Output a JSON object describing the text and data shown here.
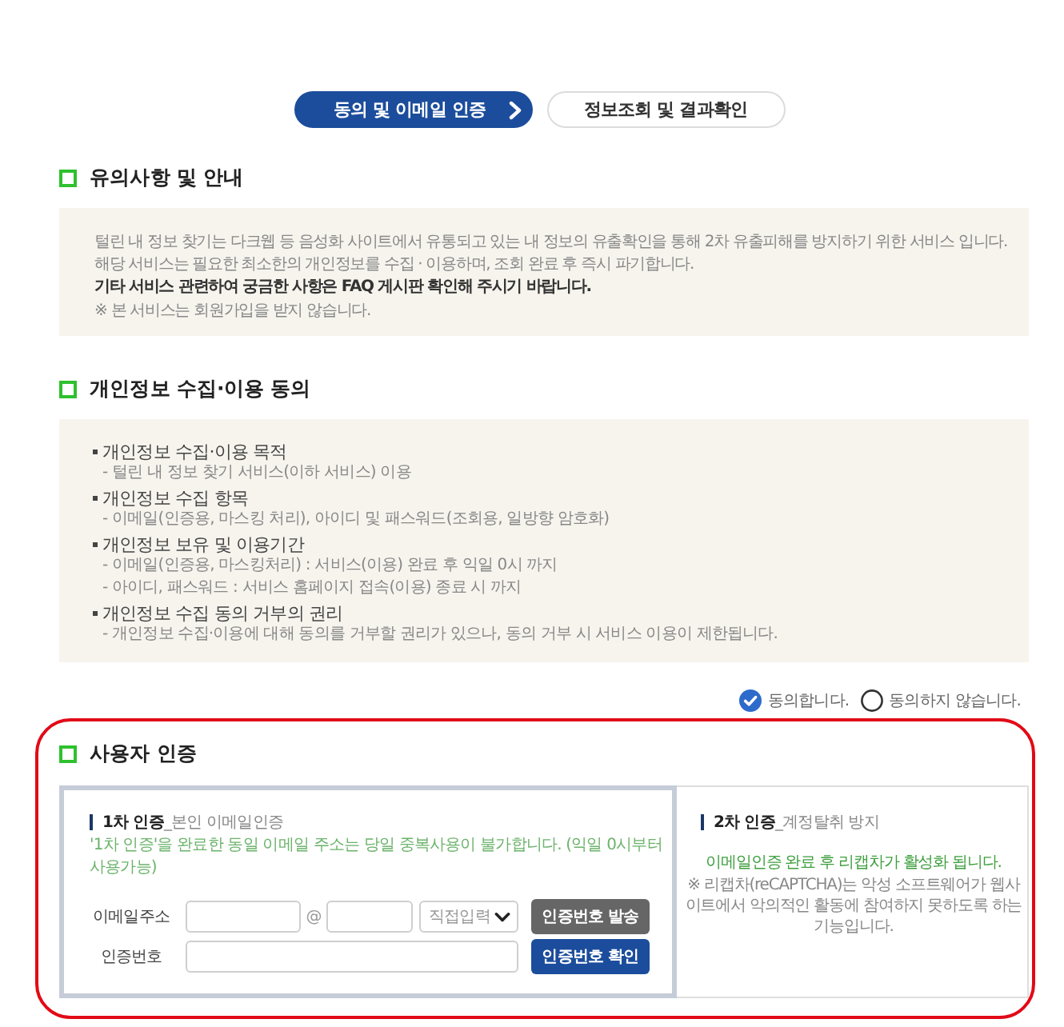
{
  "steps": [
    {
      "label": "동의 및 이메일 인증",
      "selected": true
    },
    {
      "label": "정보조회 및 결과확인",
      "selected": false
    }
  ],
  "notice": {
    "title": "유의사항 및 안내",
    "lines": [
      {
        "text": "털린 내 정보 찾기는 다크웹 등 음성화 사이트에서 유통되고 있는 내 정보의 유출확인을 통해 2차 유출피해를 방지하기 위한 서비스 입니다.",
        "bold": false
      },
      {
        "text": "해당 서비스는 필요한 최소한의 개인정보를 수집 · 이용하며, 조회 완료 후 즉시 파기합니다.",
        "bold": false
      },
      {
        "text": "기타 서비스 관련하여 궁금한 사항은 FAQ 게시판 확인해 주시기 바랍니다.",
        "bold": true
      },
      {
        "text": "※ 본 서비스는 회원가입을 받지 않습니다.",
        "bold": false
      }
    ]
  },
  "consent": {
    "title": "개인정보 수집·이용 동의",
    "items": [
      {
        "heading": "개인정보 수집·이용 목적",
        "details": [
          "- 털린 내 정보 찾기 서비스(이하 서비스) 이용"
        ]
      },
      {
        "heading": "개인정보 수집 항목",
        "details": [
          "- 이메일(인증용, 마스킹 처리), 아이디 및 패스워드(조회용, 일방향 암호화)"
        ]
      },
      {
        "heading": "개인정보 보유 및 이용기간",
        "details": [
          "- 이메일(인증용, 마스킹처리) : 서비스(이용) 완료 후 익일 0시 까지",
          "- 아이디, 패스워드 : 서비스 홈페이지 접속(이용) 종료 시 까지"
        ]
      },
      {
        "heading": "개인정보 수집 동의 거부의 권리",
        "details": [
          "- 개인정보 수집·이용에 대해 동의를 거부할 권리가 있으나, 동의 거부 시 서비스 이용이 제한됩니다."
        ]
      }
    ],
    "options": [
      {
        "label": "동의합니다.",
        "selected": true
      },
      {
        "label": "동의하지 않습니다.",
        "selected": false
      }
    ]
  },
  "user_auth": {
    "title": "사용자 인증",
    "first": {
      "title": "1차 인증",
      "subtitle": "_본인 이메일인증",
      "notice": "'1차 인증'을 완료한 동일 이메일 주소는 당일 중복사용이 불가합니다. (익일 0시부터 사용가능)",
      "email_label": "이메일주소",
      "at_sign": "@",
      "domain_select": "직접입력",
      "send_button": "인증번호 발송",
      "code_label": "인증번호",
      "confirm_button": "인증번호 확인"
    },
    "second": {
      "title": "2차 인증",
      "subtitle": "_계정탈취 방지",
      "status": "이메일인증 완료 후 리캡차가 활성화 됩니다.",
      "note": "※ 리캡차(reCAPTCHA)는 악성 소프트웨어가 웹사이트에서 악의적인 활동에 참여하지 못하도록 하는 기능입니다."
    }
  }
}
